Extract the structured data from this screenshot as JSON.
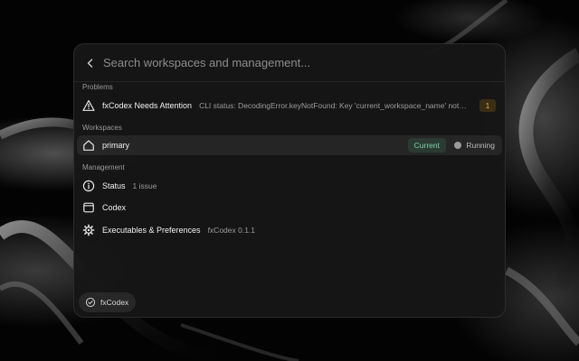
{
  "search": {
    "placeholder": "Search workspaces and management..."
  },
  "sections": {
    "problems": "Problems",
    "workspaces": "Workspaces",
    "management": "Management"
  },
  "problems": [
    {
      "title": "fxCodex Needs Attention",
      "detail": "CLI status: DecodingError.keyNotFound: Key 'current_workspace_name' not found",
      "count": "1",
      "icon": "warning-icon"
    }
  ],
  "workspaces": [
    {
      "name": "primary",
      "badge": "Current",
      "status": "Running",
      "icon": "home-icon"
    }
  ],
  "management": [
    {
      "title": "Status",
      "detail": "1 issue",
      "icon": "info-icon"
    },
    {
      "title": "Codex",
      "detail": "",
      "icon": "window-icon"
    },
    {
      "title": "Executables & Preferences",
      "detail": "fxCodex 0.1.1",
      "icon": "gear-icon"
    }
  ],
  "footer": {
    "chip_label": "fxCodex",
    "chip_icon": "app-logo-icon"
  },
  "colors": {
    "current_badge_text": "#7fd3a6",
    "count_badge_text": "#e0b84d"
  }
}
